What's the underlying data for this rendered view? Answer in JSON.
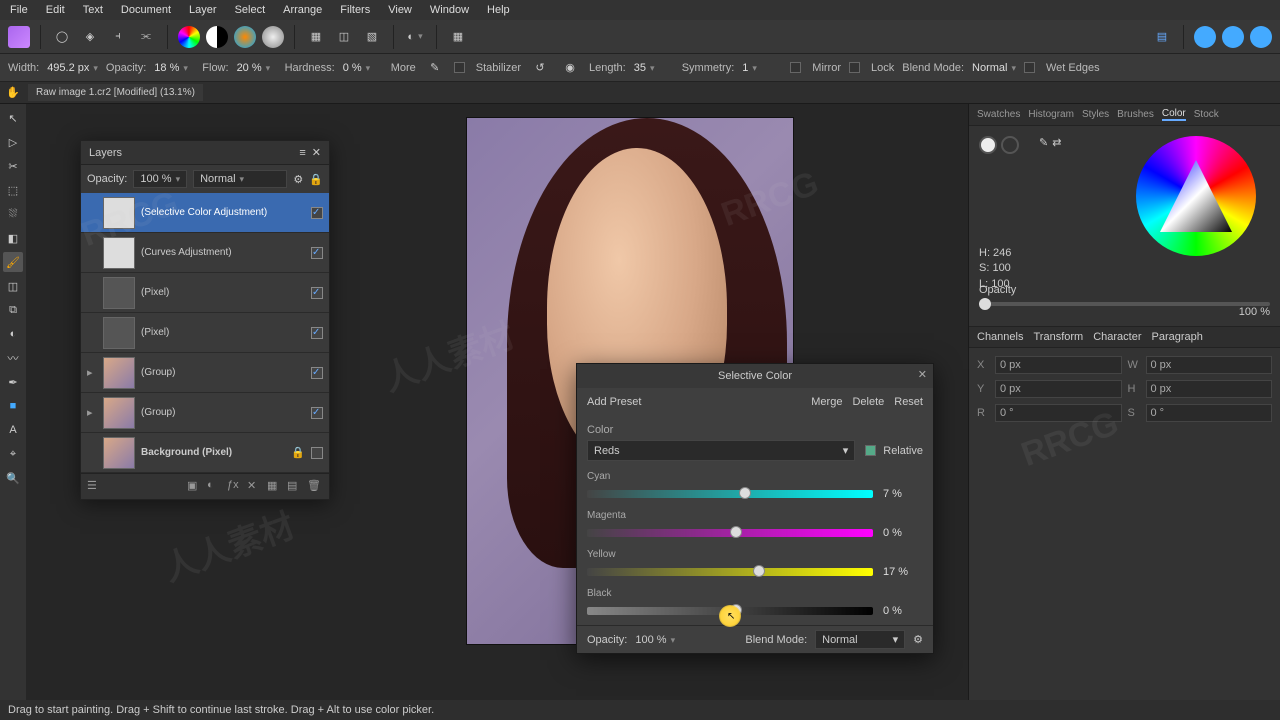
{
  "menubar": {
    "items": [
      "File",
      "Edit",
      "Text",
      "Document",
      "Layer",
      "Select",
      "Arrange",
      "Filters",
      "View",
      "Window",
      "Help"
    ]
  },
  "toolbar2": {
    "width_label": "Width:",
    "width_val": "495.2 px",
    "opacity_label": "Opacity:",
    "opacity_val": "18 %",
    "flow_label": "Flow:",
    "flow_val": "20 %",
    "hardness_label": "Hardness:",
    "hardness_val": "0 %",
    "more": "More",
    "stabilizer": "Stabilizer",
    "length_label": "Length:",
    "length_val": "35",
    "symmetry_label": "Symmetry:",
    "symmetry_val": "1",
    "mirror": "Mirror",
    "lock": "Lock",
    "blend_label": "Blend Mode:",
    "blend_val": "Normal",
    "wet": "Wet Edges"
  },
  "doc_tab": "Raw image 1.cr2 [Modified] (13.1%)",
  "right_tabs_top": [
    "Swatches",
    "Histogram",
    "Styles",
    "Brushes",
    "Color",
    "Stock"
  ],
  "right_tabs_top_active": "Color",
  "color_panel": {
    "H": "H: 246",
    "S": "S: 100",
    "L": "L: 100",
    "opacity_label": "Opacity",
    "opacity_val": "100 %"
  },
  "right_tabs_mid": [
    "Channels",
    "Transform",
    "Character",
    "Paragraph"
  ],
  "right_tabs_mid_active": "Transform",
  "transform": {
    "x": "0 px",
    "w": "0 px",
    "y": "0 px",
    "h": "0 px",
    "r": "0 °",
    "s": "0 °"
  },
  "layers_panel": {
    "title": "Layers",
    "opacity_label": "Opacity:",
    "opacity_val": "100 %",
    "blend": "Normal",
    "layers": [
      {
        "name": "(Selective Color Adjustment)",
        "sel": true,
        "thumb": "white",
        "chk": true
      },
      {
        "name": "(Curves Adjustment)",
        "sel": false,
        "thumb": "white",
        "chk": true
      },
      {
        "name": "(Pixel)",
        "sel": false,
        "thumb": "dark",
        "chk": true
      },
      {
        "name": "(Pixel)",
        "sel": false,
        "thumb": "dark",
        "chk": true
      },
      {
        "name": "(Group)",
        "sel": false,
        "thumb": "photo",
        "chk": true,
        "expand": true
      },
      {
        "name": "(Group)",
        "sel": false,
        "thumb": "photo",
        "chk": true,
        "expand": true
      },
      {
        "name": "Background (Pixel)",
        "sel": false,
        "thumb": "photo",
        "chk": false,
        "lock": true
      }
    ]
  },
  "selective_color": {
    "title": "Selective Color",
    "add_preset": "Add Preset",
    "merge": "Merge",
    "delete": "Delete",
    "reset": "Reset",
    "color_label": "Color",
    "color_val": "Reds",
    "relative": "Relative",
    "sliders": [
      {
        "name": "Cyan",
        "class": "t-cyan",
        "val": "7 %",
        "pos": 53
      },
      {
        "name": "Magenta",
        "class": "t-mag",
        "val": "0 %",
        "pos": 50
      },
      {
        "name": "Yellow",
        "class": "t-yel",
        "val": "17 %",
        "pos": 58
      },
      {
        "name": "Black",
        "class": "t-blk",
        "val": "0 %",
        "pos": 50
      }
    ],
    "footer": {
      "opacity_label": "Opacity:",
      "opacity_val": "100 %",
      "blend_label": "Blend Mode:",
      "blend_val": "Normal"
    }
  },
  "statusbar": "Drag to start painting. Drag + Shift to continue last stroke. Drag + Alt to use color picker.",
  "watermark": "www.rrcg.cn"
}
